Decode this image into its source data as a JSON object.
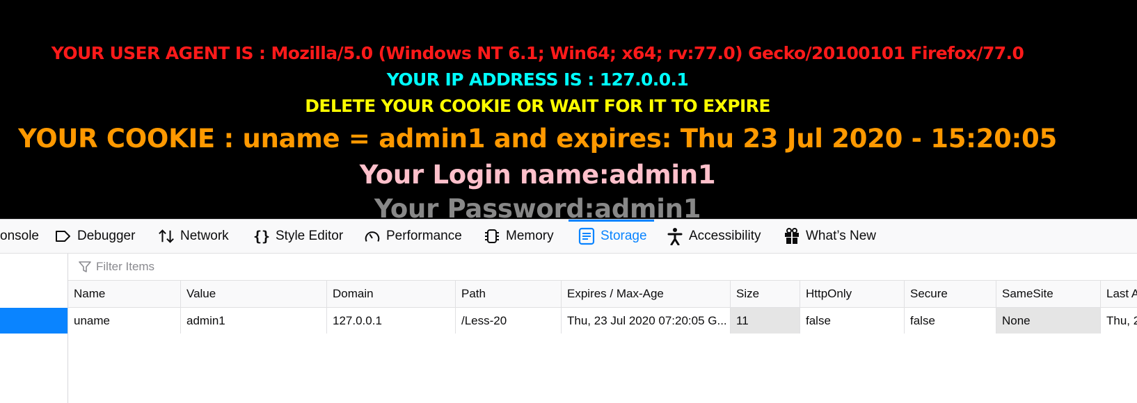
{
  "page": {
    "user_agent_line": "YOUR USER AGENT IS : Mozilla/5.0 (Windows NT 6.1; Win64; x64; rv:77.0) Gecko/20100101 Firefox/77.0",
    "ip_line": "YOUR IP ADDRESS IS : 127.0.0.1",
    "delete_line": "DELETE YOUR COOKIE OR WAIT FOR IT TO EXPIRE",
    "cookie_line": "YOUR COOKIE : uname = admin1 and expires: Thu 23 Jul 2020 - 15:20:05",
    "login_line": "Your Login name:admin1",
    "password_line": "Your Password:admin1",
    "colors": {
      "red": "#ff1a1a",
      "cyan": "#00ffff",
      "yellow": "#ffff00",
      "orange": "#ff9900",
      "pink": "#ffc0cb",
      "gray": "#888888"
    }
  },
  "devtools": {
    "tabs": [
      {
        "label": "onsole",
        "icon": "console-icon"
      },
      {
        "label": "Debugger",
        "icon": "debugger-icon"
      },
      {
        "label": "Network",
        "icon": "network-arrows-icon"
      },
      {
        "label": "Style Editor",
        "icon": "curly-braces-icon"
      },
      {
        "label": "Performance",
        "icon": "gauge-icon"
      },
      {
        "label": "Memory",
        "icon": "memory-chip-icon"
      },
      {
        "label": "Storage",
        "icon": "storage-icon",
        "selected": true
      },
      {
        "label": "Accessibility",
        "icon": "accessibility-person-icon"
      },
      {
        "label": "What’s New",
        "icon": "gift-icon"
      }
    ],
    "accent": "#0a84ff",
    "filter": {
      "placeholder": "Filter Items",
      "icon": "filter-funnel-icon"
    },
    "table": {
      "columns": [
        "Name",
        "Value",
        "Domain",
        "Path",
        "Expires / Max-Age",
        "Size",
        "HttpOnly",
        "Secure",
        "SameSite",
        "Last A"
      ],
      "rows": [
        [
          "uname",
          "admin1",
          "127.0.0.1",
          "/Less-20",
          "Thu, 23 Jul 2020 07:20:05 G...",
          "11",
          "false",
          "false",
          "None",
          "Thu, 2"
        ]
      ]
    }
  }
}
